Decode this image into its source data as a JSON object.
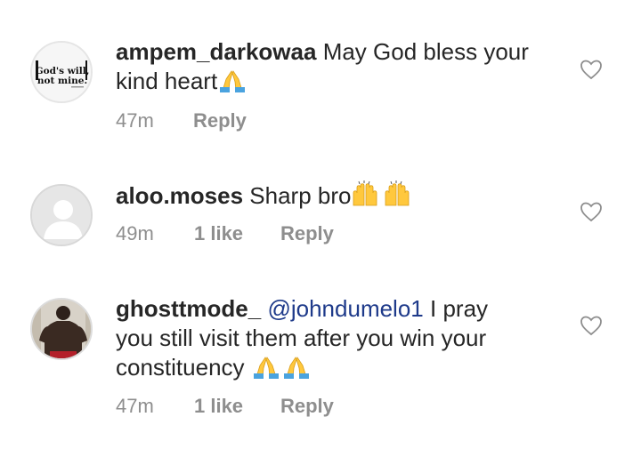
{
  "comments": [
    {
      "username": "ampem_darkowaa",
      "text": "May God bless your kind heart",
      "text_line1": "May God bless your",
      "text_line2": "kind heart",
      "emoji": "folded-hands",
      "time": "47m",
      "reply_label": "Reply",
      "avatar_text_line1": "God's will,",
      "avatar_text_line2": "not mine."
    },
    {
      "username": "aloo.moses",
      "text": "Sharp bro",
      "emoji": "raising-hands",
      "time": "49m",
      "likes": "1 like",
      "reply_label": "Reply"
    },
    {
      "username": "ghosttmode_",
      "mention": "@johndumelo1",
      "text": "I pray you still visit them after you win your constituency",
      "text_line1": "I pray",
      "text_line2": "you still visit them after you win your",
      "text_line3": "constituency",
      "emoji": "folded-hands",
      "time": "47m",
      "likes": "1 like",
      "reply_label": "Reply"
    }
  ],
  "colors": {
    "text": "#262626",
    "meta": "#8e8e8e",
    "mention": "#1e3a8a",
    "emoji_sleeve": "#4aa3df",
    "emoji_hand": "#ffc83d"
  }
}
